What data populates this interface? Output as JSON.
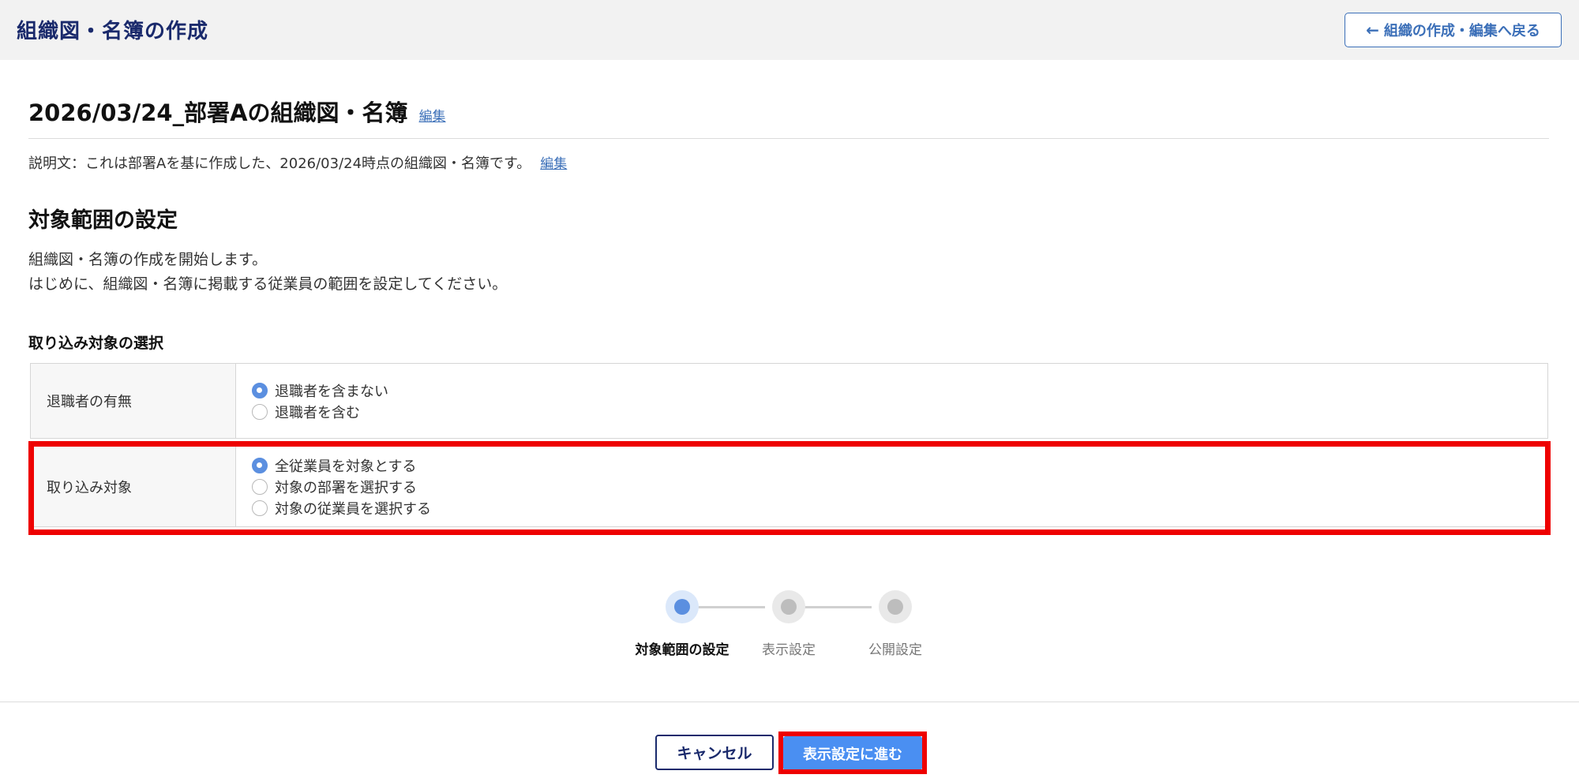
{
  "header": {
    "title": "組織図・名簿の作成",
    "back_button_label": "組織の作成・編集へ戻る",
    "back_icon": "arrow-left-icon"
  },
  "document": {
    "title": "2026/03/24_部署Aの組織図・名簿",
    "edit_link": "編集",
    "description": "説明文：これは部署Aを基に作成した、2026/03/24時点の組織図・名簿です。",
    "description_edit_link": "編集"
  },
  "section": {
    "title": "対象範囲の設定",
    "intro_line1": "組織図・名簿の作成を開始します。",
    "intro_line2": "はじめに、組織図・名簿に掲載する従業員の範囲を設定してください。",
    "subtitle": "取り込み対象の選択"
  },
  "settings": {
    "retired": {
      "label": "退職者の有無",
      "options": [
        {
          "label": "退職者を含まない",
          "checked": true
        },
        {
          "label": "退職者を含む",
          "checked": false
        }
      ]
    },
    "target": {
      "label": "取り込み対象",
      "options": [
        {
          "label": "全従業員を対象とする",
          "checked": true
        },
        {
          "label": "対象の部署を選択する",
          "checked": false
        },
        {
          "label": "対象の従業員を選択する",
          "checked": false
        }
      ]
    }
  },
  "stepper": {
    "steps": [
      {
        "label": "対象範囲の設定",
        "active": true
      },
      {
        "label": "表示設定",
        "active": false
      },
      {
        "label": "公開設定",
        "active": false
      }
    ]
  },
  "footer": {
    "cancel_label": "キャンセル",
    "next_label": "表示設定に進む"
  },
  "colors": {
    "brand_navy": "#1a2a6c",
    "accent_blue": "#5b8fe0",
    "highlight_red": "#ee0000"
  }
}
